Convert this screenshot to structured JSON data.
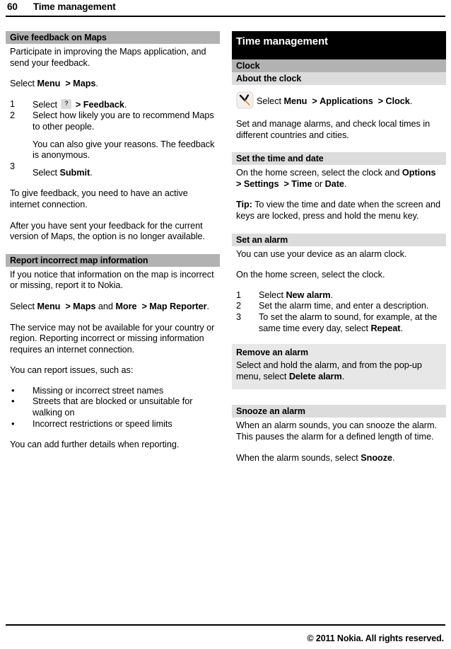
{
  "running_head": {
    "page_number": "60",
    "title": "Time management"
  },
  "left_column": {
    "section1": {
      "heading": "Give feedback on Maps",
      "intro": "Participate in improving the Maps application, and send your feedback.",
      "select_line_prefix": "Select ",
      "select_line_menu": "Menu",
      "select_line_arrow": ">",
      "select_line_target": "Maps",
      "select_line_suffix": ".",
      "steps": [
        {
          "num": "1",
          "prefix": "Select ",
          "icon": "help-question-icon",
          "icon_glyph": "?",
          "arrow": ">",
          "bold": "Feedback",
          "suffix": "."
        },
        {
          "num": "2",
          "text": "Select how likely you are to recommend Maps to other people.",
          "substep": "You can also give your reasons. The feedback is anonymous."
        },
        {
          "num": "3",
          "prefix": "Select ",
          "bold": "Submit",
          "suffix": "."
        }
      ],
      "para_feedback": "To give feedback, you need to have an active internet connection.",
      "para_after": "After you have sent your feedback for the current version of Maps, the option is no longer available."
    },
    "section2": {
      "heading": "Report incorrect map information",
      "intro": "If you notice that information on the map is incorrect or missing, report it to Nokia.",
      "select_prefix": "Select ",
      "select_menu": "Menu",
      "select_arrow1": ">",
      "select_maps": "Maps",
      "select_and": " and ",
      "select_more": "More",
      "select_arrow2": ">",
      "select_reporter": "Map Reporter",
      "select_suffix": ".",
      "para_service": "The service may not be available for your country or region. Reporting incorrect or missing information requires an internet connection.",
      "issues_intro": "You can report issues, such as:",
      "issues": [
        "Missing or incorrect street names",
        "Streets that are blocked or unsuitable for walking on",
        "Incorrect restrictions or speed limits"
      ],
      "para_details": "You can add further details when reporting."
    }
  },
  "right_column": {
    "chapter_title": "Time management",
    "section_clock": "Clock",
    "about": {
      "heading": "About the clock",
      "icon": "clock-icon",
      "select_prefix": "Select ",
      "select_menu": "Menu",
      "arrow1": ">",
      "select_applications": "Applications",
      "arrow2": ">",
      "select_clock": "Clock",
      "select_suffix": ".",
      "body": "Set and manage alarms, and check local times in different countries and cities."
    },
    "time_and_date": {
      "heading": "Set the time and date",
      "line_prefix": "On the home screen, select the clock and ",
      "options": "Options",
      "arrow1": ">",
      "settings": "Settings",
      "arrow2": ">",
      "time": "Time",
      "or": " or ",
      "date": "Date",
      "suffix": ".",
      "tip_label": "Tip:",
      "tip_text": " To view the time and date when the screen and keys are locked, press and hold the menu key."
    },
    "set_alarm": {
      "heading": "Set an alarm",
      "intro": "You can use your device as an alarm clock.",
      "home": "On the home screen, select the clock.",
      "steps": [
        {
          "num": "1",
          "prefix": "Select ",
          "bold": "New alarm",
          "suffix": "."
        },
        {
          "num": "2",
          "text": "Set the alarm time, and enter a description."
        },
        {
          "num": "3",
          "prefix": "To set the alarm to sound, for example, at the same time every day, select ",
          "bold": "Repeat",
          "suffix": "."
        }
      ]
    },
    "remove_alarm": {
      "heading": "Remove an alarm",
      "prefix": "Select and hold the alarm, and from the pop-up menu, select ",
      "bold": "Delete alarm",
      "suffix": "."
    },
    "snooze_alarm": {
      "heading": "Snooze an alarm",
      "body": "When an alarm sounds, you can snooze the alarm. This pauses the alarm for a defined length of time.",
      "line_prefix": "When the alarm sounds, select ",
      "bold": "Snooze",
      "suffix": "."
    }
  },
  "footer": {
    "copyright": "© 2011 Nokia. All rights reserved."
  },
  "colors": {
    "h1_bg": "#000000",
    "h2_bg": "#b2b2b2",
    "h4_bg": "#dcdcdc",
    "callout_bg": "#e7e7e7",
    "text": "#000000"
  }
}
